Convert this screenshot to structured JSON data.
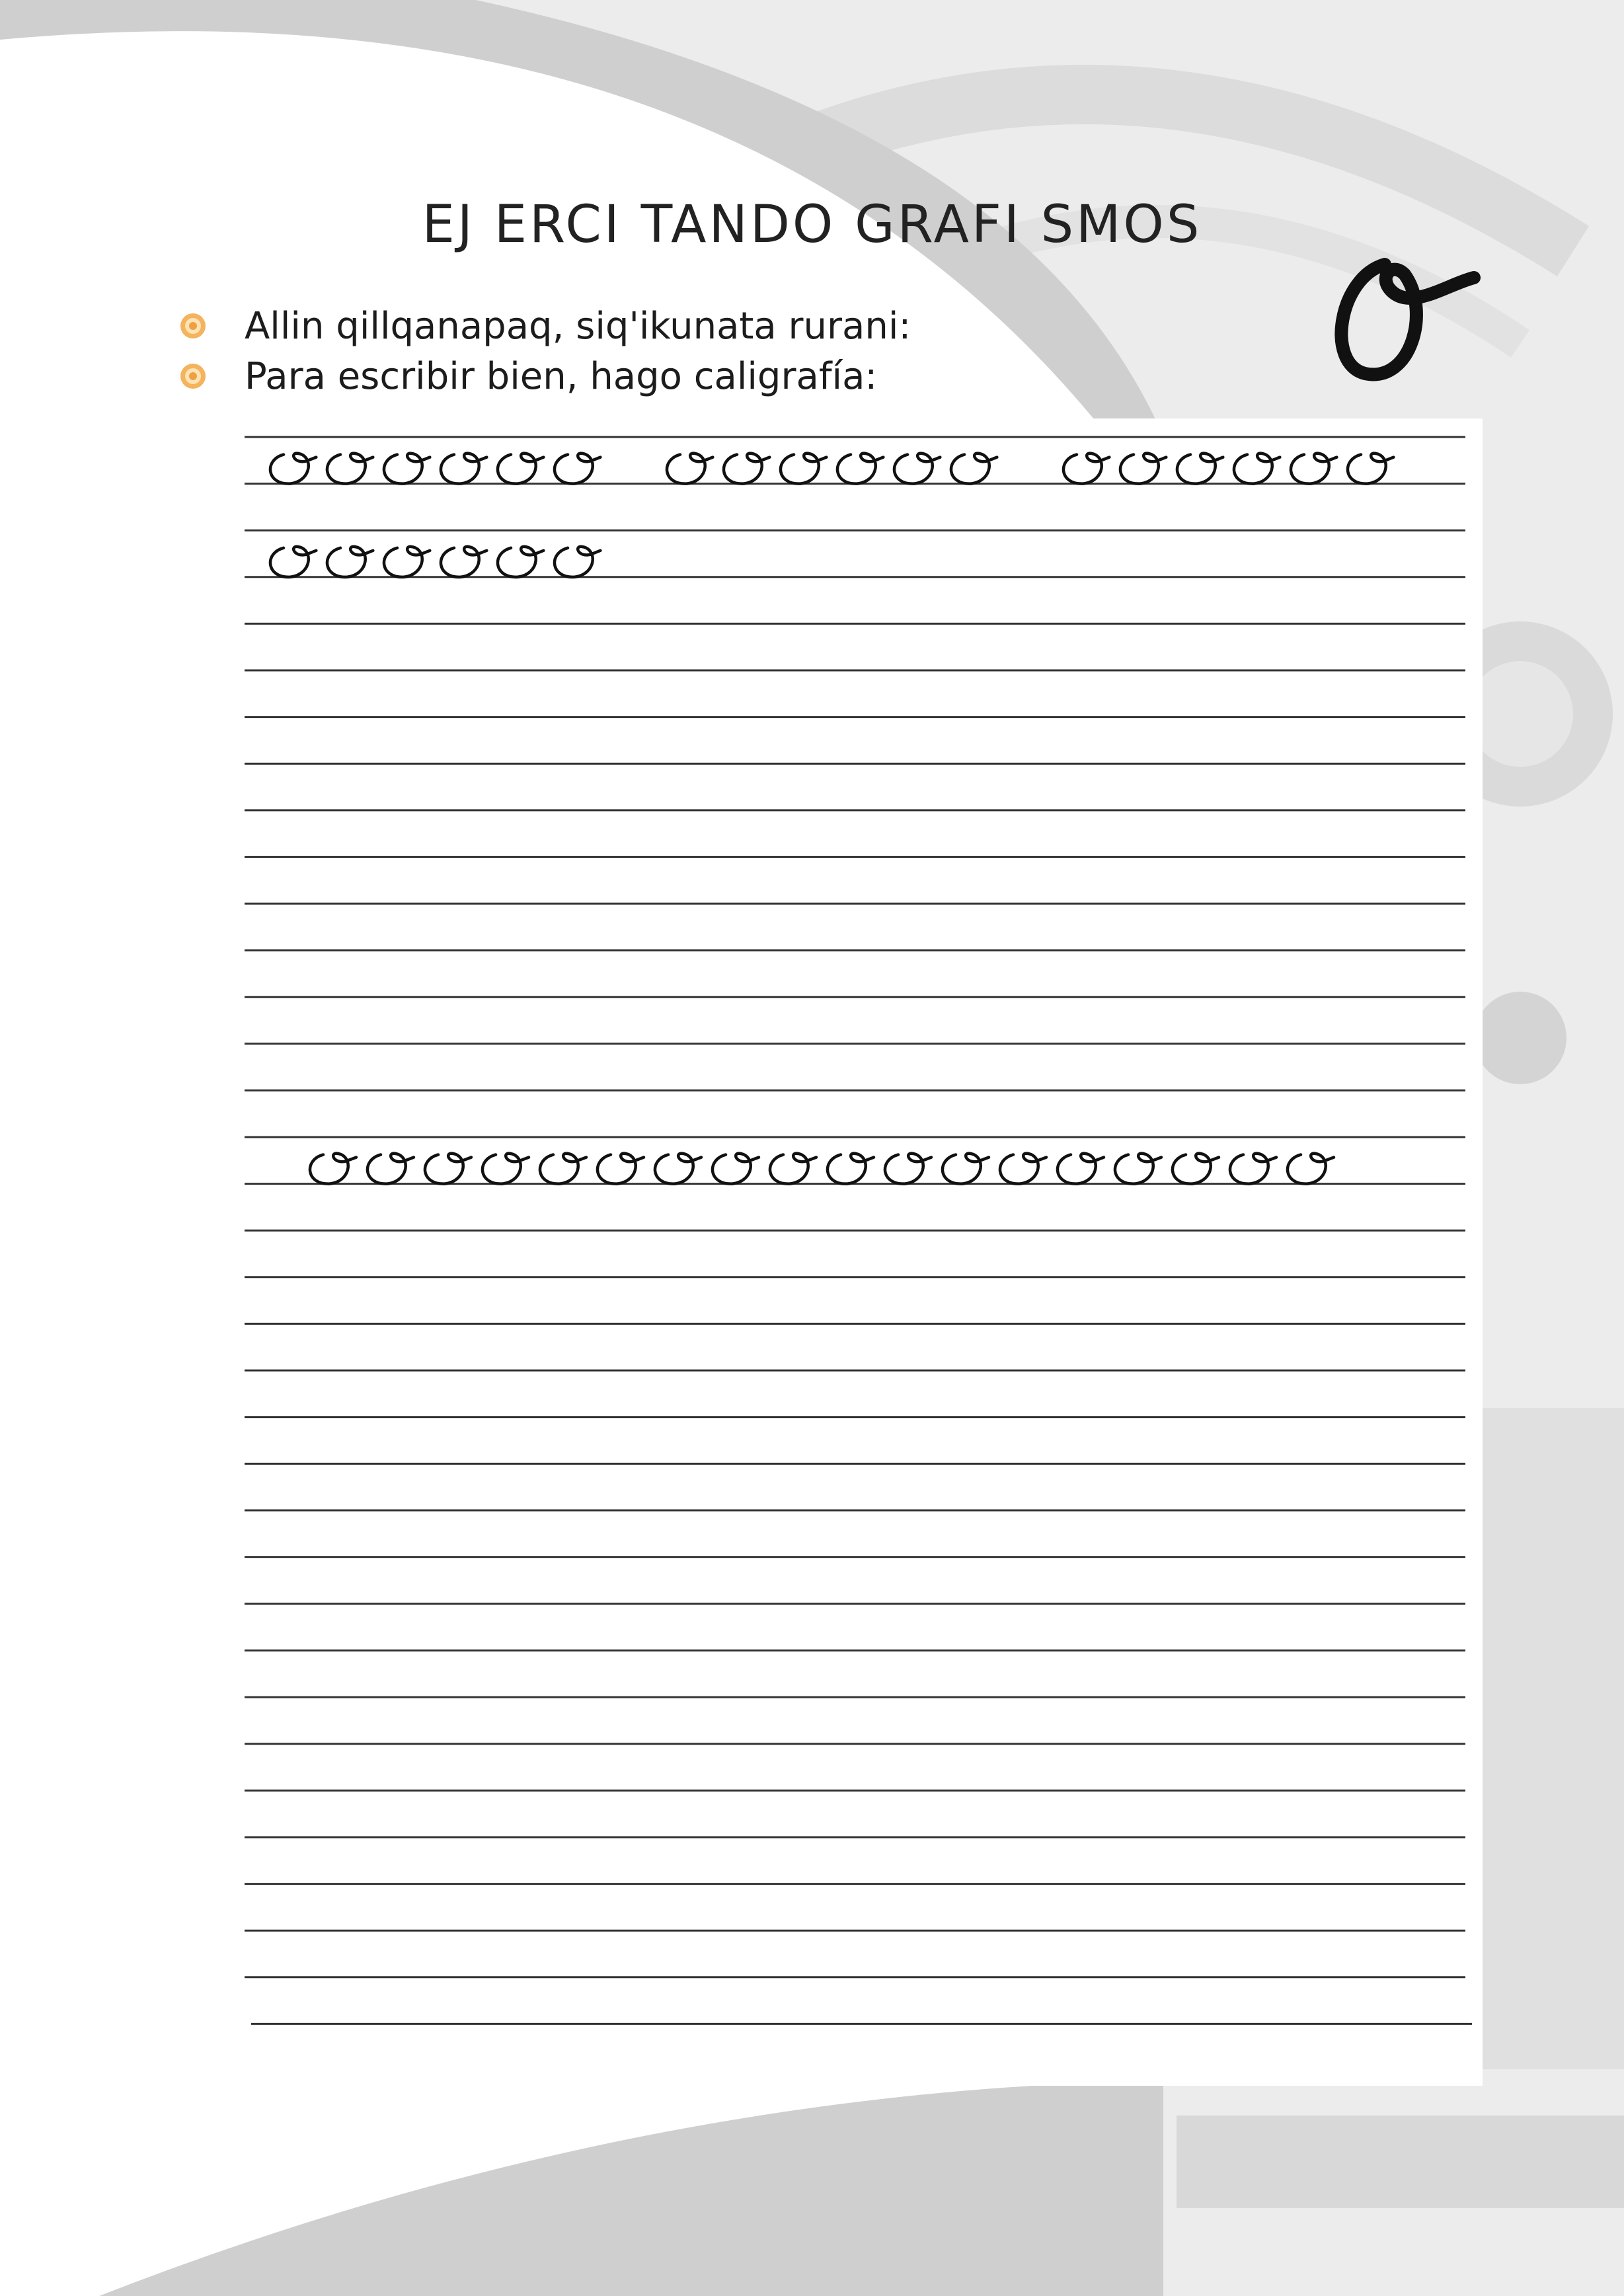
{
  "header": {
    "title": "EJ ERCI TANDO GRAFI SMOS"
  },
  "instructions": [
    {
      "icon": "flower-bullet-icon",
      "text": "Allin qillqanapaq, siq'ikunata rurani:"
    },
    {
      "icon": "flower-bullet-icon",
      "text": "Para escribir bien, hago caligrafía:"
    }
  ],
  "featured_letter": "o",
  "practice": {
    "rows": [
      {
        "line": 1,
        "groups": [
          6,
          6,
          6
        ]
      },
      {
        "line": 3,
        "groups": [
          6
        ]
      },
      {
        "line": 16,
        "groups": [
          18
        ]
      }
    ]
  },
  "colors": {
    "ink": "#111111",
    "bullet": "#f0a040",
    "background_shade": "#d0d0d0"
  }
}
